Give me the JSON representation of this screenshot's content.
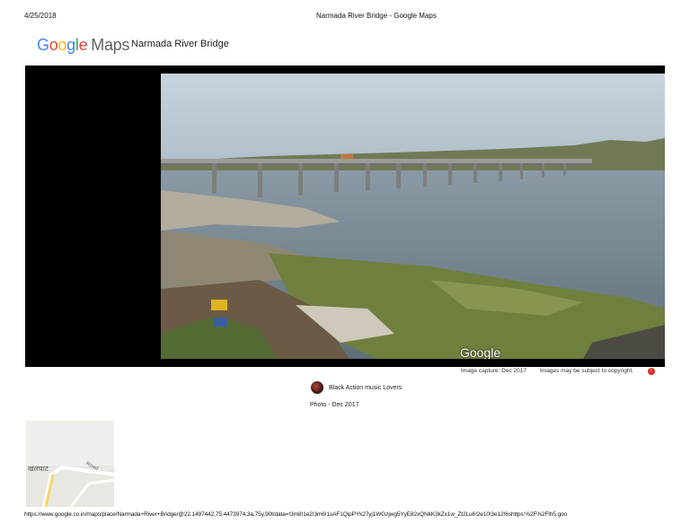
{
  "header": {
    "date": "4/25/2018",
    "title": "Narmada River Bridge - Google Maps"
  },
  "logo": {
    "google": "Google",
    "maps": "Maps"
  },
  "place": {
    "name": "Narmada River Bridge"
  },
  "viewer": {
    "watermark": "Google",
    "image_capture": "Image capture: Dec 2017",
    "copyright": "Images may be subject to copyright."
  },
  "author": {
    "name": "Black Action music Lovers",
    "photo_date": "Photo - Dec 2017"
  },
  "minimap": {
    "label_main": "खलघाट",
    "label_road": "Road"
  },
  "footer": {
    "url": "https://www.google.co.in/maps/place/Narmada+River+Bridge/@22.1497442,75.4473974,3a,75y,90t/data=!3m8!1e2!3m6!1sAF1QipPYk27yj1WGzjwg5YyE82xQNkK3kZx1w_Zt2Lu6!2e10!3e12!6shttps:%2F%2Flh5.goo"
  },
  "colors": {
    "sky": "#b6c6d4",
    "water": "#7b8a96",
    "algae": "#6d7d3a",
    "report": "#d93025"
  },
  "icons": {
    "report": "flag-icon",
    "avatar": "avatar"
  }
}
